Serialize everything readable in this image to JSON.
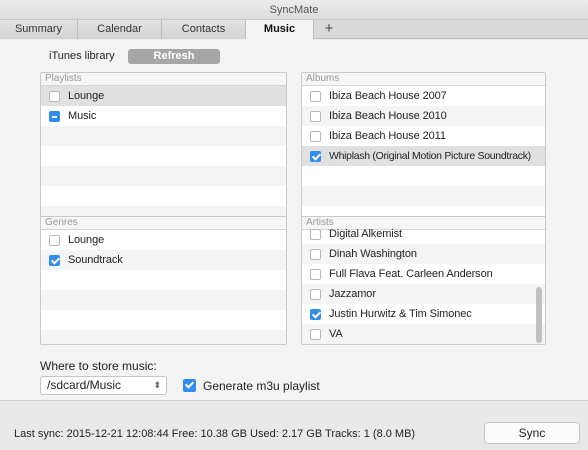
{
  "window": {
    "title": "SyncMate"
  },
  "tabs": [
    {
      "label": "Summary"
    },
    {
      "label": "Calendar"
    },
    {
      "label": "Contacts"
    },
    {
      "label": "Music"
    }
  ],
  "tab_add_label": "+",
  "itunes": {
    "label": "iTunes library",
    "refresh_label": "Refresh"
  },
  "playlists": {
    "title": "Playlists",
    "items": [
      {
        "label": "Lounge",
        "state": "unchecked"
      },
      {
        "label": "Music",
        "state": "mixed"
      }
    ]
  },
  "albums": {
    "title": "Albums",
    "items": [
      {
        "label": "Ibiza Beach House 2007",
        "state": "unchecked"
      },
      {
        "label": "Ibiza Beach House 2010",
        "state": "unchecked"
      },
      {
        "label": "Ibiza Beach House 2011",
        "state": "unchecked"
      },
      {
        "label": "Whiplash (Original Motion Picture Soundtrack)",
        "state": "checked"
      }
    ]
  },
  "genres": {
    "title": "Genres",
    "items": [
      {
        "label": "Lounge",
        "state": "unchecked"
      },
      {
        "label": "Soundtrack",
        "state": "checked"
      }
    ]
  },
  "artists": {
    "title": "Artists",
    "items": [
      {
        "label": "Digital Alkemist",
        "state": "unchecked"
      },
      {
        "label": "Dinah Washington",
        "state": "unchecked"
      },
      {
        "label": "Full Flava Feat. Carleen Anderson",
        "state": "unchecked"
      },
      {
        "label": "Jazzamor",
        "state": "unchecked"
      },
      {
        "label": "Justin Hurwitz & Tim Simonec",
        "state": "checked"
      },
      {
        "label": "VA",
        "state": "unchecked"
      }
    ]
  },
  "storage": {
    "label": "Where to store music:",
    "path": "/sdcard/Music",
    "m3u_label": "Generate m3u playlist",
    "m3u_checked": true
  },
  "status": {
    "text": "Last sync: 2015-12-21 12:08:44  Free: 10.38 GB  Used: 2.17 GB  Tracks: 1 (8.0 MB)",
    "sync_label": "Sync"
  },
  "colors": {
    "accent": "#2f8cf0",
    "refresh_bg": "#a6a6a6"
  }
}
